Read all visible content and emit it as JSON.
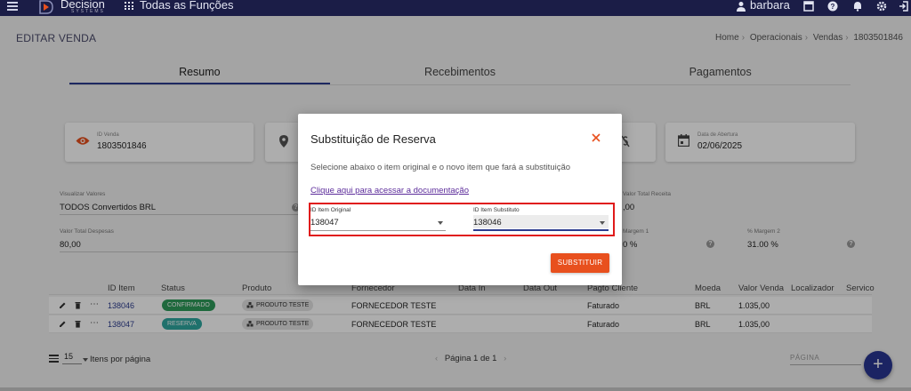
{
  "topbar": {
    "logo_text": "Decision",
    "logo_sub": "SYSTEMS",
    "apps_label": "Todas as Funções",
    "user_name": "barbara"
  },
  "header": {
    "page_title": "EDITAR VENDA",
    "breadcrumb": [
      "Home",
      "Operacionais",
      "Vendas",
      "1803501846"
    ]
  },
  "tabs": [
    {
      "label": "Resumo",
      "active": true
    },
    {
      "label": "Recebimentos",
      "active": false
    },
    {
      "label": "Pagamentos",
      "active": false
    }
  ],
  "cards": {
    "id_venda": {
      "label": "ID Venda",
      "value": "1803501846",
      "icon": "eye-icon"
    },
    "data_abertura": {
      "label": "Data de Abertura",
      "value": "02/06/2025",
      "icon": "calendar-icon"
    }
  },
  "fields": {
    "visualizar_valores": {
      "label": "Visualizar Valores",
      "value": "TODOS Convertidos BRL"
    },
    "valor_total_receita": {
      "label": "Valor Total Receita",
      "value": ",00"
    },
    "valor_total_despesas": {
      "label": "Valor Total Despesas",
      "value": "80,00"
    },
    "margem_1": {
      "label": "Margem 1",
      "value": "0 %"
    },
    "margem_2": {
      "label": "% Margem 2",
      "value": "31.00 %"
    }
  },
  "table": {
    "headers": [
      "ID Item",
      "Status",
      "Produto",
      "Fornecedor",
      "Data In",
      "Data Out",
      "Pagto Cliente",
      "Moeda",
      "Valor Venda",
      "Localizador",
      "Servico"
    ],
    "rows": [
      {
        "id_item": "138046",
        "status": "CONFIRMADO",
        "status_color": "#2e9b5b",
        "produto": "PRODUTO TESTE",
        "fornecedor": "FORNECEDOR TESTE",
        "pagto_cliente": "Faturado",
        "moeda": "BRL",
        "valor_venda": "1.035,00"
      },
      {
        "id_item": "138047",
        "status": "RESERVA",
        "status_color": "#2ea7a0",
        "produto": "PRODUTO TESTE",
        "fornecedor": "FORNECEDOR TESTE",
        "pagto_cliente": "Faturado",
        "moeda": "BRL",
        "valor_venda": "1.035,00"
      }
    ]
  },
  "pager": {
    "per_page_value": "15",
    "per_page_label": "Itens por página",
    "page_text": "Página 1 de 1",
    "page_search_placeholder": "PÁGINA"
  },
  "fab_label": "+",
  "modal": {
    "title": "Substituição de Reserva",
    "description": "Selecione abaixo o item original e o novo item que fará a substituição",
    "doc_link": "Clique aqui para acessar a documentação",
    "original_label": "ID Item Original",
    "original_value": "138047",
    "substitute_label": "ID Item Substituto",
    "substitute_value": "138046",
    "submit_label": "SUBSTITUIR"
  },
  "colors": {
    "topbar": "#1b1d47",
    "accent": "#2c3c8f",
    "button": "#e8501e",
    "highlight": "#e01b1b"
  }
}
